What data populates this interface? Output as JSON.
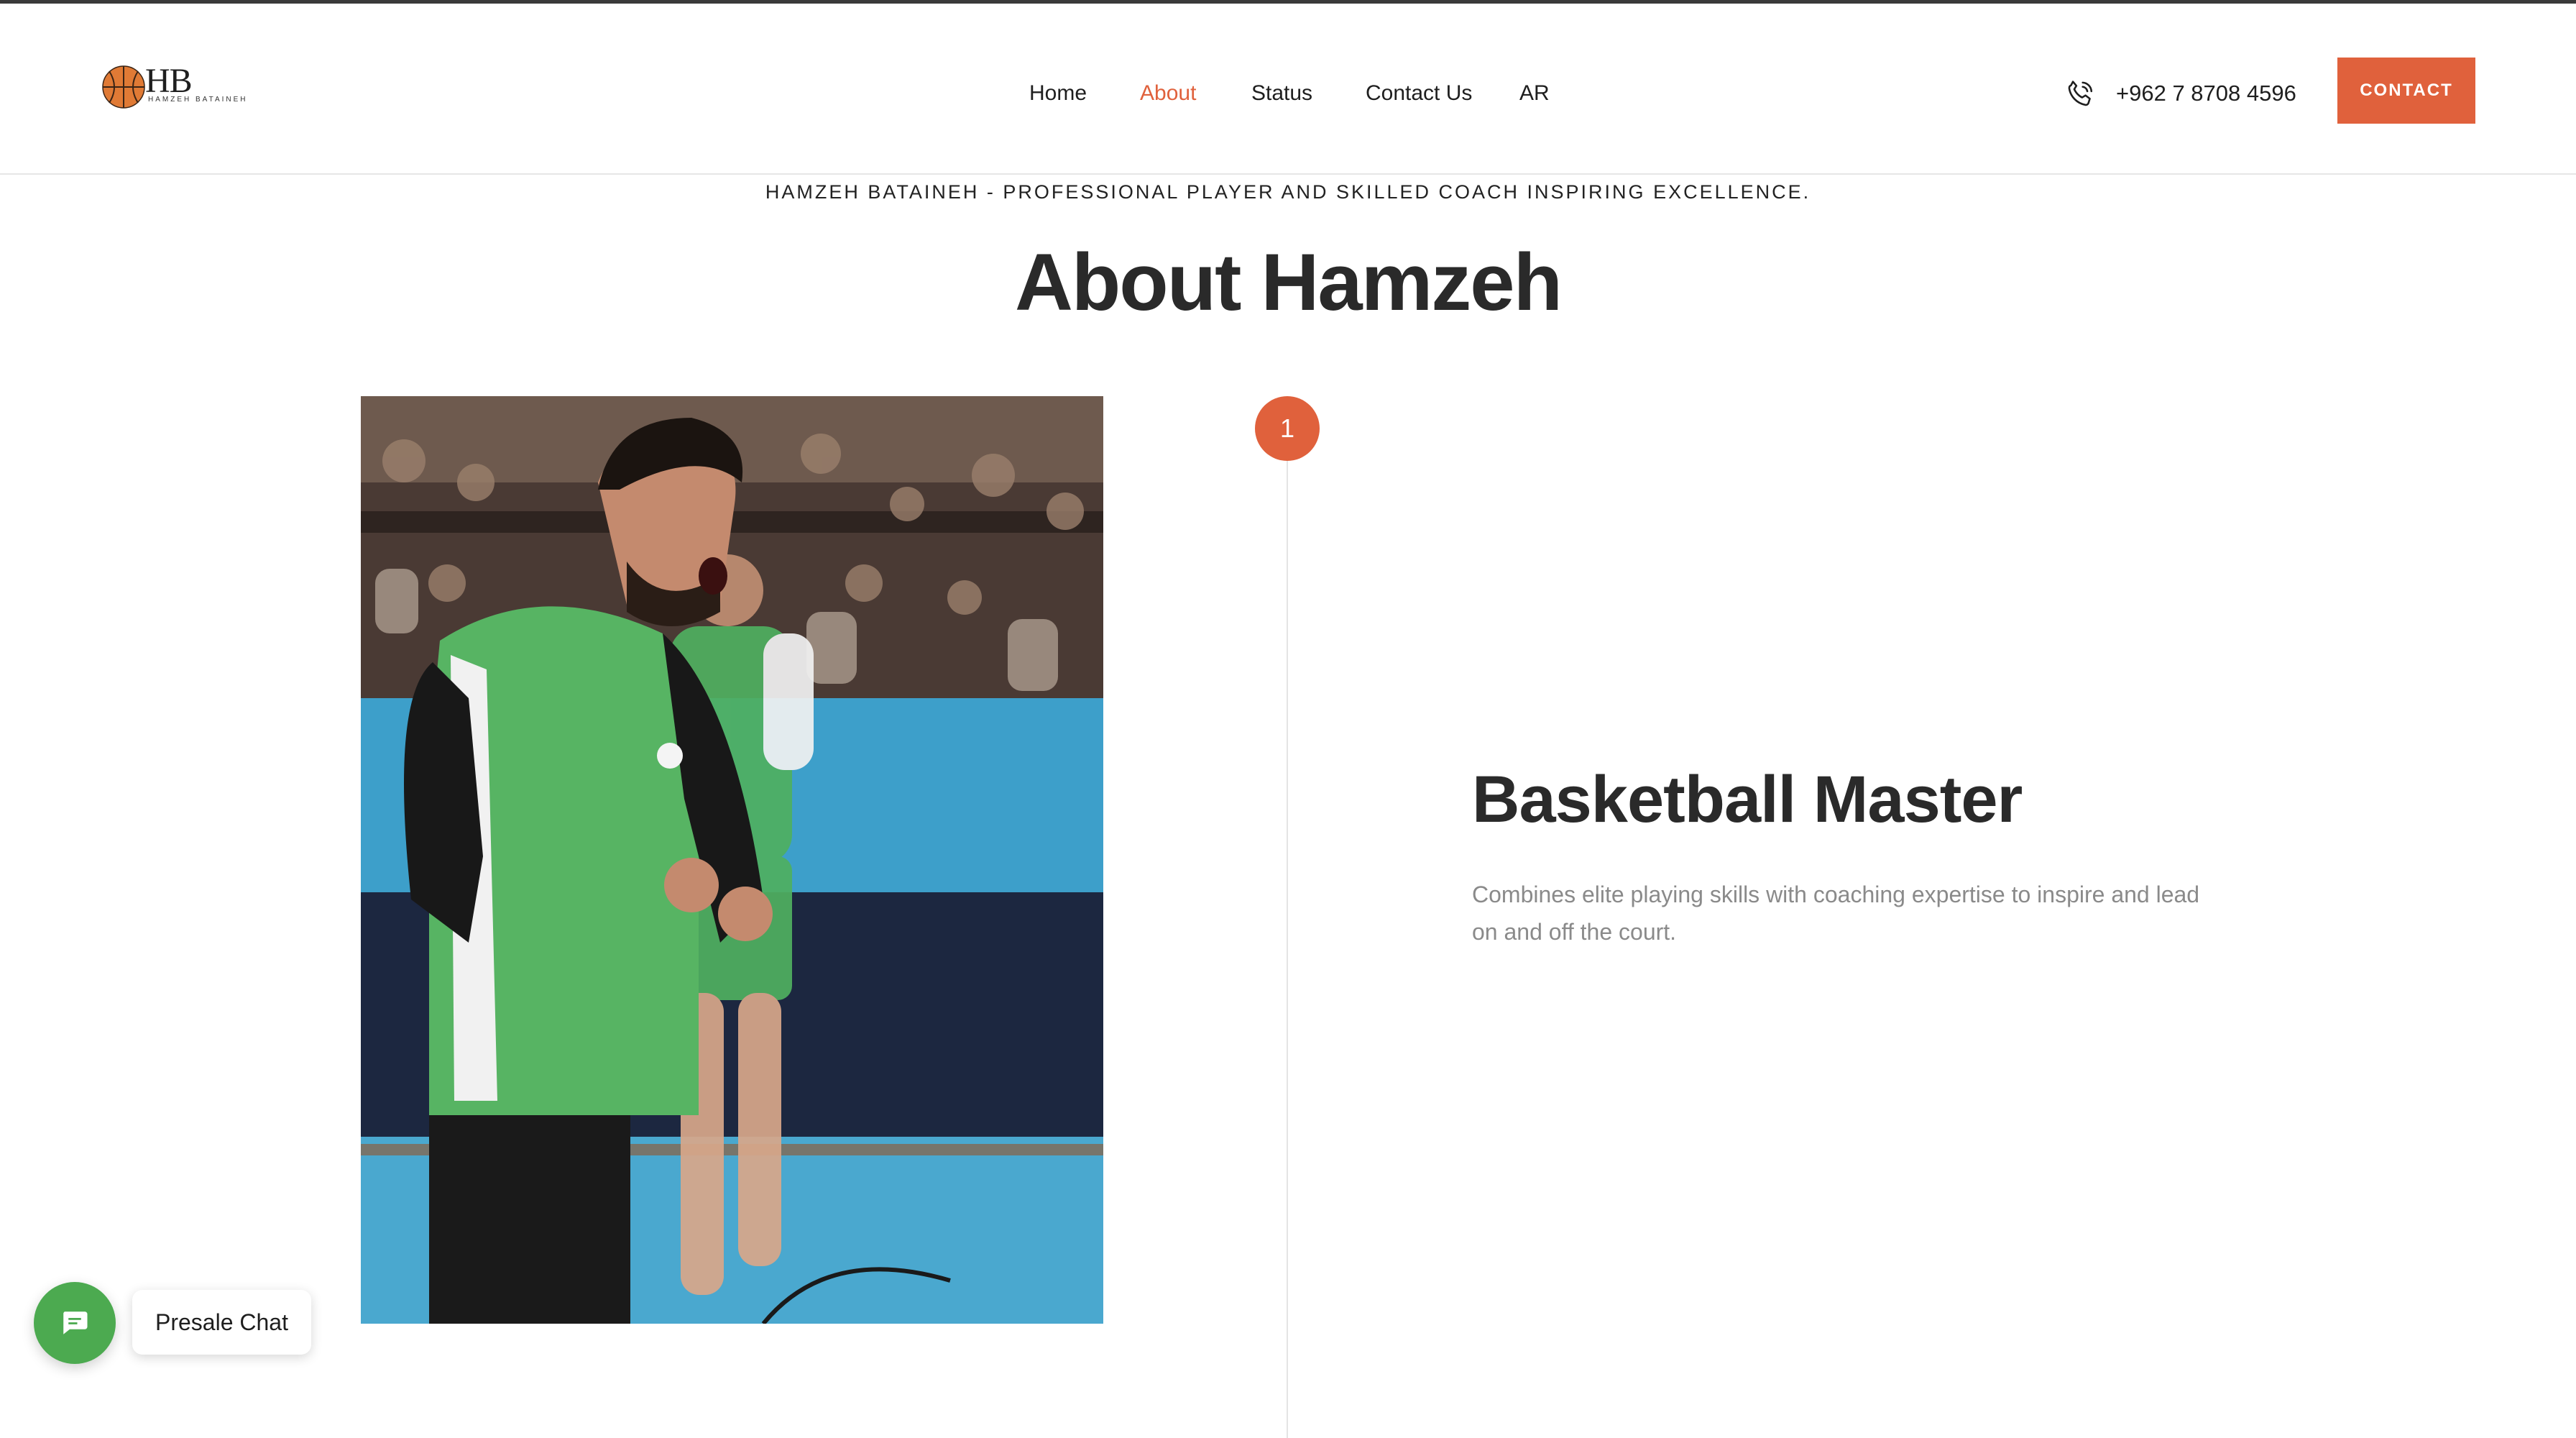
{
  "brand": {
    "logo_letters": "HB",
    "logo_subtitle": "HAMZEH BATAINEH",
    "logo_icon": "basketball-icon"
  },
  "nav": {
    "items": [
      {
        "label": "Home"
      },
      {
        "label": "About"
      },
      {
        "label": "Status"
      },
      {
        "label": "Contact Us"
      },
      {
        "label": "AR"
      }
    ],
    "active": "About"
  },
  "header": {
    "phone": "+962 7 8708 4596",
    "phone_icon": "phone-icon",
    "contact_label": "CONTACT"
  },
  "about": {
    "tagline": "HAMZEH BATAINEH - PROFESSIONAL PLAYER AND SKILLED COACH INSPIRING EXCELLENCE.",
    "title": "About Hamzeh",
    "step_number": "1",
    "feature_title": "Basketball Master",
    "feature_description": "Combines elite playing skills with coaching expertise to inspire and lead on and off the court."
  },
  "chat": {
    "label": "Presale Chat",
    "icon": "chat-bubble-icon"
  },
  "colors": {
    "accent": "#e0613c",
    "chat_green": "#4caa50",
    "text_dark": "#2a2a2a",
    "text_muted": "#8a8a8a"
  }
}
